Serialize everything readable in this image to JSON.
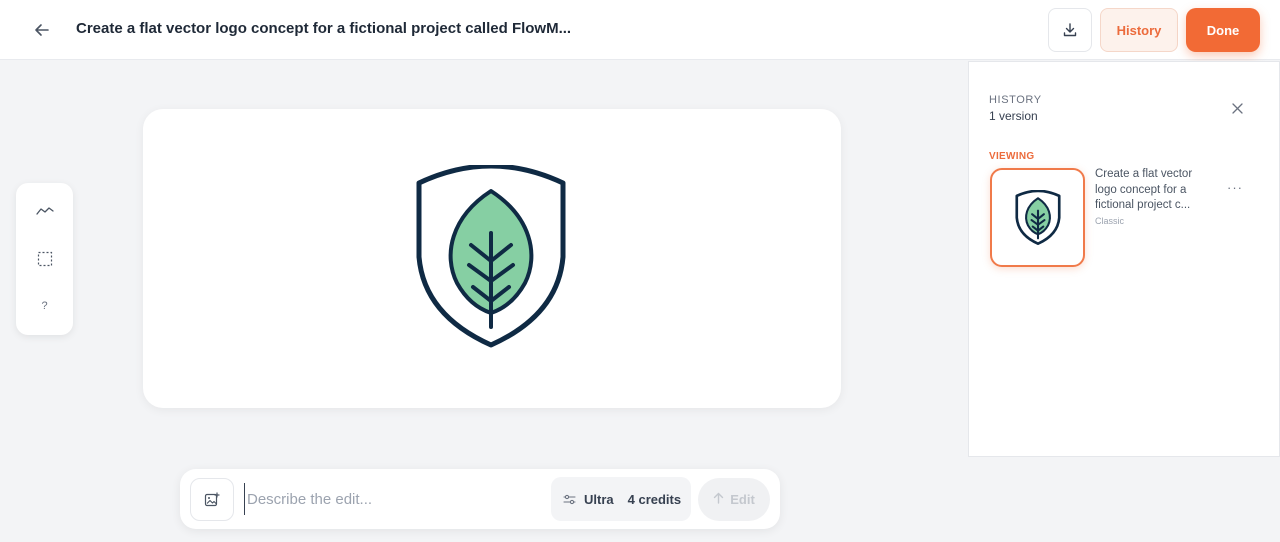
{
  "header": {
    "title": "Create a flat vector logo concept for a fictional project called FlowM...",
    "history_label": "History",
    "done_label": "Done"
  },
  "toolbar": {
    "help_label": "?"
  },
  "canvas": {
    "logo_colors": {
      "outline": "#0f2a44",
      "leaf": "#86cfa3"
    }
  },
  "prompt_bar": {
    "placeholder": "Describe the edit...",
    "model": "Ultra",
    "credits": "4 credits",
    "submit_label": "Edit"
  },
  "history_panel": {
    "title": "HISTORY",
    "count": "1 version",
    "viewing_label": "VIEWING",
    "versions": [
      {
        "title": "Create a flat vector logo concept for a fictional project c...",
        "tag": "Classic"
      }
    ]
  },
  "colors": {
    "accent": "#f26a35",
    "accent_soft": "#fdf2ec"
  }
}
